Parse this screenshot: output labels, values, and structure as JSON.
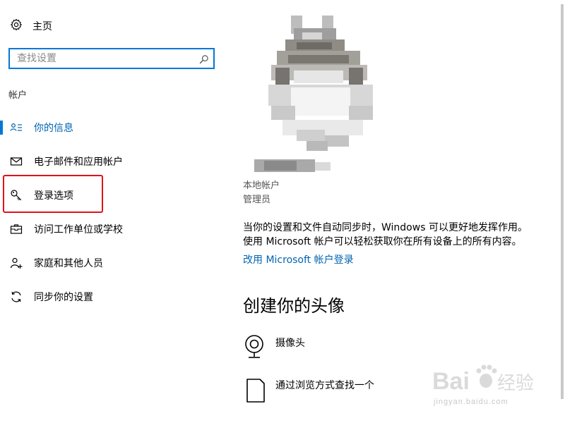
{
  "sidebar": {
    "home_label": "主页",
    "search_placeholder": "查找设置",
    "section_title": "帐户",
    "items": [
      {
        "label": "你的信息",
        "icon": "person-list-icon",
        "selected": true
      },
      {
        "label": "电子邮件和应用帐户",
        "icon": "mail-icon",
        "selected": false
      },
      {
        "label": "登录选项",
        "icon": "key-icon",
        "selected": false
      },
      {
        "label": "访问工作单位或学校",
        "icon": "briefcase-icon",
        "selected": false
      },
      {
        "label": "家庭和其他人员",
        "icon": "person-add-icon",
        "selected": false
      },
      {
        "label": "同步你的设置",
        "icon": "sync-icon",
        "selected": false
      }
    ]
  },
  "main": {
    "account_type": "本地帐户",
    "account_role": "管理员",
    "sync_text_line1": "当你的设置和文件自动同步时，Windows 可以更好地发挥作用。",
    "sync_text_line2": "使用 Microsoft 帐户可以轻松获取你在所有设备上的所有内容。",
    "ms_link": "改用 Microsoft 帐户登录",
    "create_heading": "创建你的头像",
    "options": [
      {
        "label": "摄像头",
        "icon": "webcam-icon"
      },
      {
        "label": "通过浏览方式查找一个",
        "icon": "document-icon"
      }
    ]
  },
  "watermark": {
    "logo_text": "Bai",
    "logo_text2": "经验",
    "sub_text": "jingyan.baidu.com"
  },
  "colors": {
    "accent": "#0078d7",
    "link": "#0063b1",
    "highlight": "#e0111b"
  }
}
